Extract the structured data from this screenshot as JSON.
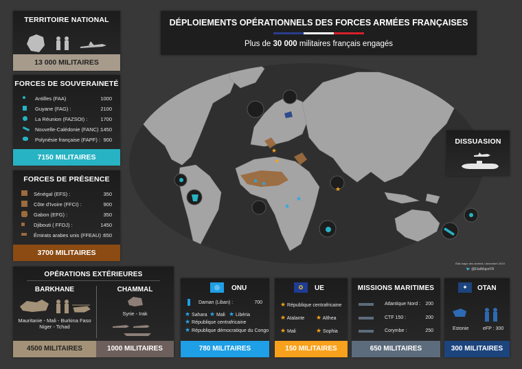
{
  "header": {
    "title": "DÉPLOIEMENTS OPÉRATIONNELS DES FORCES ARMÉES FRANÇAISES",
    "subtitle_prefix": "Plus de ",
    "subtitle_strong": "30 000",
    "subtitle_suffix": " militaires français engagés"
  },
  "territoire": {
    "title": "TERRITOIRE NATIONAL",
    "total": "13 000 MILITAIRES"
  },
  "souverainete": {
    "title": "FORCES DE SOUVERAINETÉ",
    "rows": [
      {
        "label": "Antilles (FAA)",
        "value": "1000"
      },
      {
        "label": "Guyane (FAG) :",
        "value": "2100"
      },
      {
        "label": "La Réunion (FAZSOI) :",
        "value": "1700"
      },
      {
        "label": "Nouvelle-Calédonie (FANC) :",
        "value": "1450"
      },
      {
        "label": "Polynésie française (FAPF) :",
        "value": "900"
      }
    ],
    "total": "7150 MILITAIRES"
  },
  "presence": {
    "title": "FORCES DE PRÉSENCE",
    "rows": [
      {
        "label": "Sénégal (EFS) :",
        "value": "350"
      },
      {
        "label": "Côte d'Ivoire  (FFCI) :",
        "value": "900"
      },
      {
        "label": "Gabon (EFG) :",
        "value": "350"
      },
      {
        "label": "Djibouti ( FFDJ) :",
        "value": "1450"
      },
      {
        "label": "Émirats arabes unis (FFEAU) :",
        "value": "650"
      }
    ],
    "total": "3700 MILITAIRES"
  },
  "dissuasion": {
    "title": "DISSUASION"
  },
  "credit": {
    "line1": "État-major des armées / décembre 2019",
    "line2": "@EtatMajorFR"
  },
  "operations": {
    "title": "OPÉRATIONS EXTÉRIEURES",
    "barkhane": {
      "title": "BARKHANE",
      "countries1": "Mauritanie - Mali - Burkina Faso",
      "countries2": "Niger - Tchad",
      "total": "4500 MILITAIRES"
    },
    "chammal": {
      "title": "CHAMMAL",
      "countries": "Syrie - Irak",
      "total": "1000 MILITAIRES"
    }
  },
  "onu": {
    "title": "ONU",
    "daman_label": "Daman (Liban) :",
    "daman_value": "700",
    "items": [
      "Sahara",
      "Mali",
      "Libéria",
      "République centrafricaine",
      "République démocratique du Congo"
    ],
    "total": "780 MILITAIRES"
  },
  "ue": {
    "title": "UE",
    "items": [
      "République centrafricaine",
      "Atalante",
      "Althea",
      "Mali",
      "Sophia"
    ],
    "total": "150 MILITAIRES"
  },
  "maritimes": {
    "title": "MISSIONS MARITIMES",
    "rows": [
      {
        "label": "Atlantique Nord :",
        "value": "200"
      },
      {
        "label": "CTF 150 :",
        "value": "200"
      },
      {
        "label": "Corymbe :",
        "value": "250"
      }
    ],
    "total": "650 MILITAIRES"
  },
  "otan": {
    "title": "OTAN",
    "estonie": "Estonie",
    "efp": "eFP : 300",
    "total": "300 MILITAIRES"
  },
  "colors": {
    "background": "#383838",
    "territoire": "#a79b8b",
    "souverainete": "#27b3c3",
    "presence": "#8b4b13",
    "barkhane": "#a49278",
    "chammal": "#6d5f5c",
    "onu": "#1e9fe6",
    "ue": "#f8a11c",
    "maritimes": "#5d6c7c",
    "otan": "#1c447d",
    "france_blue": "#2a3d8f",
    "france_red": "#d8202a"
  }
}
